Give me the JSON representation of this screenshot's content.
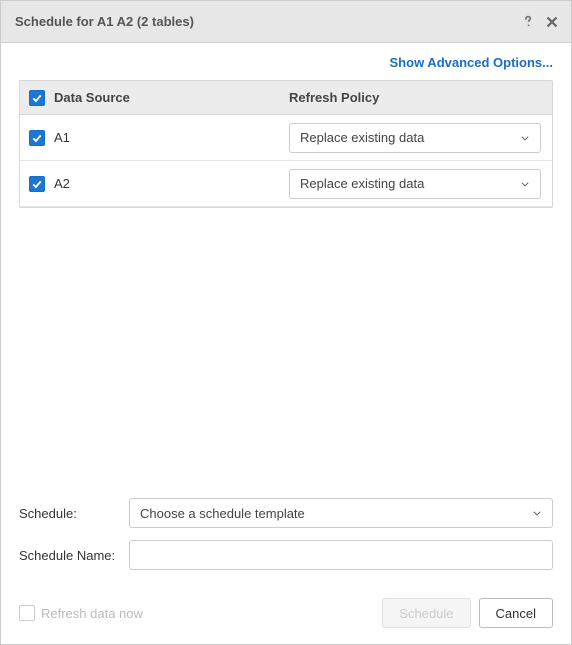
{
  "header": {
    "title": "Schedule for A1 A2 (2 tables)"
  },
  "advanced_link": "Show Advanced Options...",
  "grid": {
    "headers": {
      "data_source": "Data Source",
      "refresh_policy": "Refresh Policy"
    },
    "rows": [
      {
        "name": "A1",
        "policy": "Replace existing data"
      },
      {
        "name": "A2",
        "policy": "Replace existing data"
      }
    ]
  },
  "form": {
    "schedule_label": "Schedule:",
    "schedule_placeholder": "Choose a schedule template",
    "name_label": "Schedule Name:",
    "name_value": ""
  },
  "footer": {
    "refresh_now": "Refresh data now",
    "schedule_btn": "Schedule",
    "cancel_btn": "Cancel"
  }
}
